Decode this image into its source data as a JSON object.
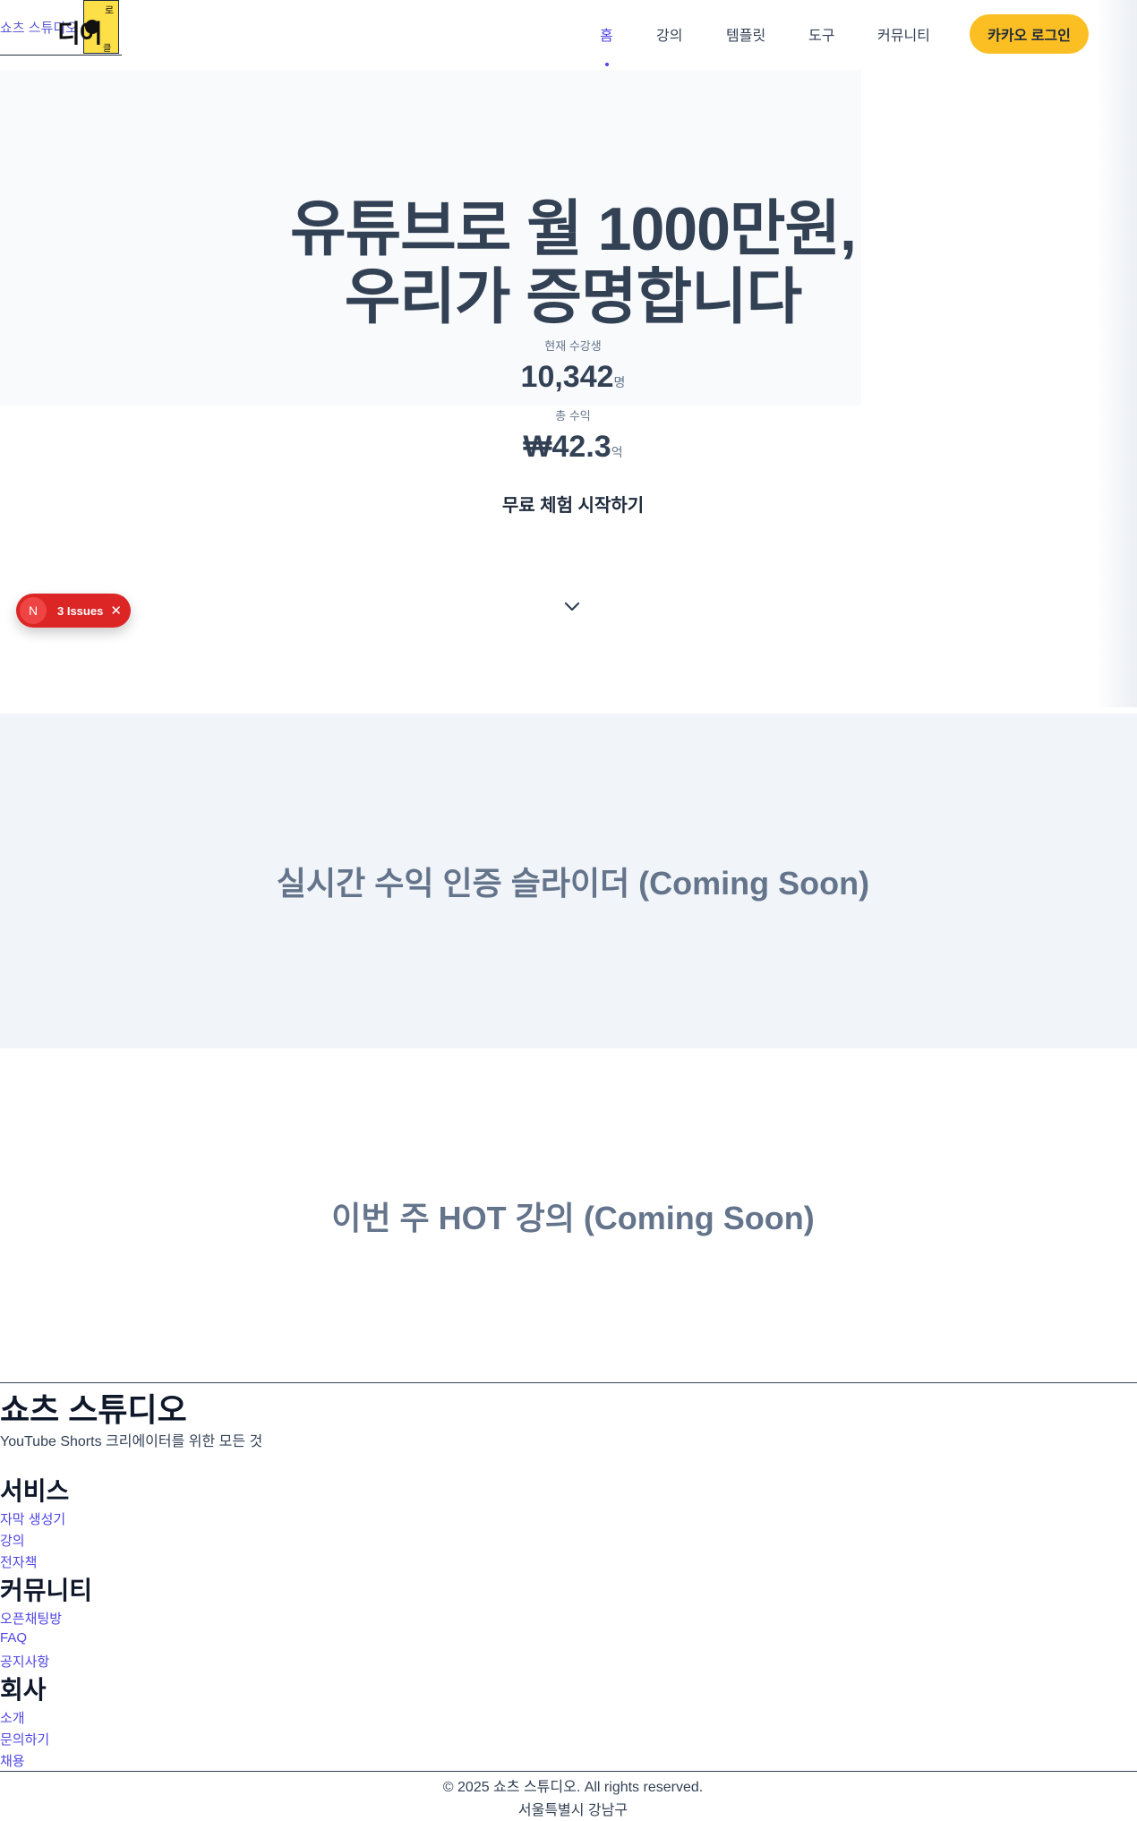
{
  "header": {
    "logo_text": "쇼츠 스튜디오",
    "logo_mark_big": "디어",
    "logo_mark_top": "로",
    "logo_mark_bottom": "클",
    "nav": [
      {
        "label": "홈"
      },
      {
        "label": "강의"
      },
      {
        "label": "템플릿"
      },
      {
        "label": "도구"
      },
      {
        "label": "커뮤니티"
      }
    ],
    "login_label": "카카오 로그인"
  },
  "hero": {
    "title_line1": "유튜브로 월 1000만원,",
    "title_line2": "우리가 증명합니다",
    "stats": [
      {
        "label": "현재 수강생",
        "value": "10,342",
        "unit": "명"
      },
      {
        "label": "총 수익",
        "value": "₩42.3",
        "unit": "억"
      }
    ],
    "cta_label": "무료 체험 시작하기"
  },
  "issues_badge": {
    "icon": "N",
    "label": "3 Issues",
    "close": "✕"
  },
  "sections": {
    "slider_title": "실시간 수익 인증 슬라이더 (Coming Soon)",
    "hot_title": "이번 주 HOT 강의 (Coming Soon)"
  },
  "footer": {
    "brand": "쇼츠 스튜디오",
    "tagline": "YouTube Shorts 크리에이터를 위한 모든 것",
    "columns": [
      {
        "heading": "서비스",
        "links": [
          "자막 생성기",
          "강의",
          "전자책"
        ]
      },
      {
        "heading": "커뮤니티",
        "links": [
          "오픈채팅방",
          "FAQ",
          "공지사항"
        ]
      },
      {
        "heading": "회사",
        "links": [
          "소개",
          "문의하기",
          "채용"
        ]
      }
    ],
    "copyright": "© 2025 쇼츠 스튜디오. All rights reserved.",
    "address": "서울특별시 강남구"
  },
  "colors": {
    "accent": "#4f46e5",
    "login_bg": "#fbbf24",
    "badge": "#dc2626"
  }
}
